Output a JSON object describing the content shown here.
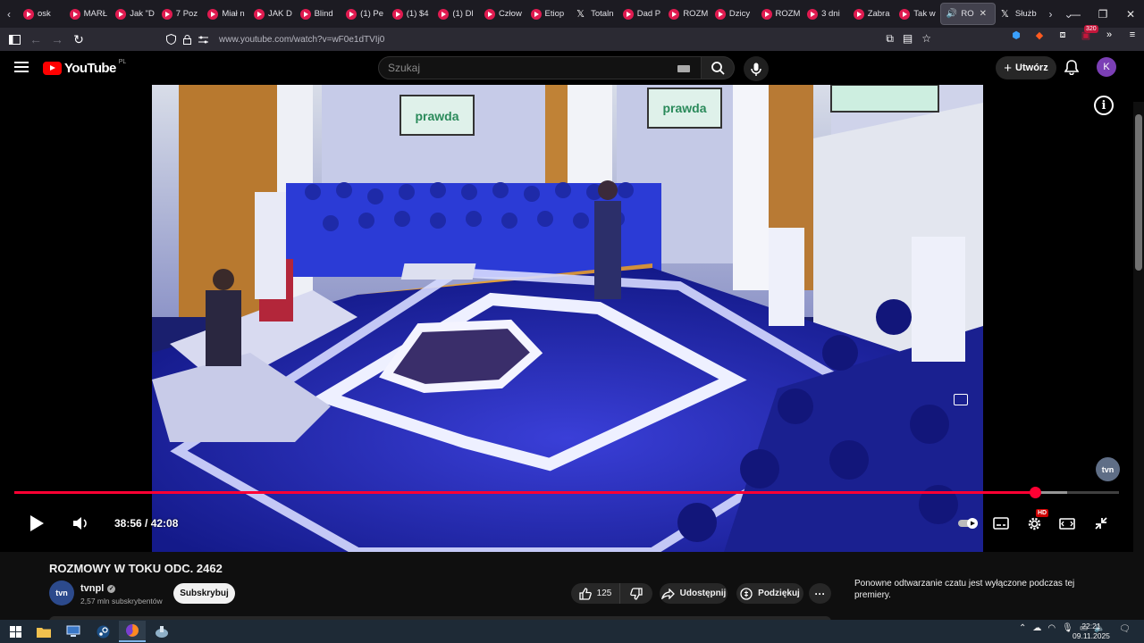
{
  "browser": {
    "tabs": [
      {
        "label": "osk",
        "icon": "youtube-icon"
      },
      {
        "label": "MARŁ",
        "icon": "youtube-icon"
      },
      {
        "label": "Jak \"D",
        "icon": "youtube-icon"
      },
      {
        "label": "7 Poz",
        "icon": "youtube-icon"
      },
      {
        "label": "Miał n",
        "icon": "youtube-icon"
      },
      {
        "label": "JAK D",
        "icon": "youtube-icon"
      },
      {
        "label": "Blind",
        "icon": "youtube-icon"
      },
      {
        "label": "(1) Pe",
        "icon": "youtube-icon"
      },
      {
        "label": "(1) $4",
        "icon": "youtube-icon"
      },
      {
        "label": "(1) Dl",
        "icon": "youtube-icon"
      },
      {
        "label": "Człow",
        "icon": "youtube-icon"
      },
      {
        "label": "Etiop",
        "icon": "youtube-icon"
      },
      {
        "label": "Totaln",
        "icon": "x-icon"
      },
      {
        "label": "Dad P",
        "icon": "youtube-icon"
      },
      {
        "label": "ROZM",
        "icon": "youtube-icon"
      },
      {
        "label": "Dzicy",
        "icon": "youtube-icon"
      },
      {
        "label": "ROZM",
        "icon": "youtube-icon"
      },
      {
        "label": "3 dni",
        "icon": "youtube-icon"
      },
      {
        "label": "Zabra",
        "icon": "youtube-icon"
      },
      {
        "label": "Tak w",
        "icon": "youtube-icon"
      }
    ],
    "active_tab": {
      "label": "RO",
      "icon": "speaker-icon"
    },
    "last_tab": {
      "label": "Służb",
      "icon": "x-icon"
    },
    "url": "www.youtube.com/watch?v=wF0e1dTVIj0",
    "extension_badge": "320"
  },
  "youtube": {
    "logo": "YouTube",
    "region": "PL",
    "search_placeholder": "Szukaj",
    "create_label": "Utwórz",
    "avatar_letter": "K",
    "player": {
      "current_time": "38:56",
      "duration": "42:08",
      "time_display": "38:56 / 42:08",
      "played_fraction": 0.924,
      "buffered_fraction": 0.953,
      "watermark": "tvn",
      "quality_badge": "HD"
    },
    "video": {
      "title": "ROZMOWY W TOKU ODC. 2462",
      "channel": "tvnpl",
      "channel_avatar": "tvn",
      "subscribers": "2,57 mln subskrybentów",
      "subscribe_label": "Subskrybuj",
      "likes": "125",
      "share_label": "Udostępnij",
      "thanks_label": "Podziękuj",
      "screen_sign_left": "prawda",
      "screen_sign_right": "prawda"
    },
    "chat_notice": "Ponowne odtwarzanie czatu jest wyłączone podczas tej premiery."
  },
  "taskbar": {
    "time": "22:21",
    "date": "09.11.2025"
  },
  "colors": {
    "accent_red": "#ff0033",
    "studio_blue": "#2a35c8",
    "youtube_red": "#ff0000"
  }
}
